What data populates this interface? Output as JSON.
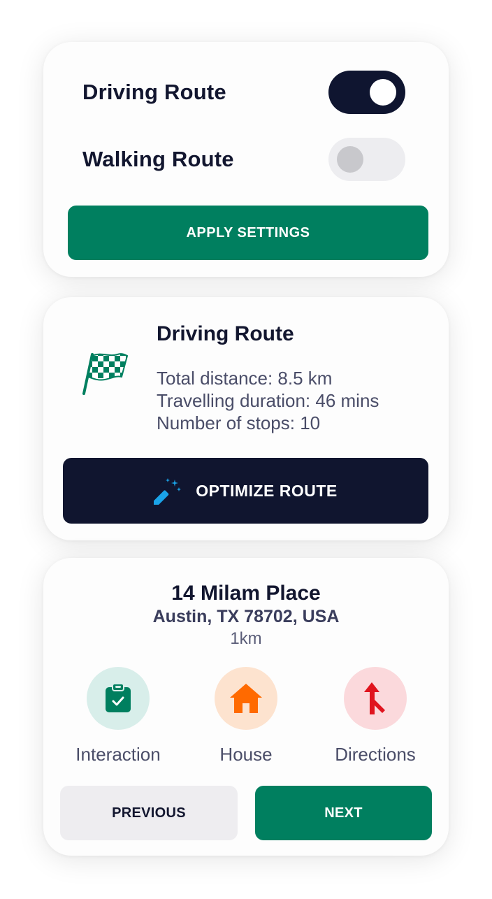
{
  "settings": {
    "driving_label": "Driving Route",
    "driving_on": true,
    "walking_label": "Walking Route",
    "walking_on": false,
    "apply_label": "APPLY SETTINGS"
  },
  "route": {
    "icon": "checkered-flag-icon",
    "title": "Driving Route",
    "total_distance": "Total distance: 8.5 km",
    "duration": "Travelling duration: 46 mins",
    "stops": "Number of stops: 10",
    "optimize_label": "OPTIMIZE ROUTE",
    "optimize_icon": "magic-wand-icon"
  },
  "stop": {
    "address_line1": "14 Milam Place",
    "address_line2": "Austin, TX 78702, USA",
    "distance": "1km",
    "actions": [
      {
        "label": "Interaction",
        "icon": "clipboard-check-icon",
        "color": "#007f5f"
      },
      {
        "label": "House",
        "icon": "house-icon",
        "color": "#ff6a00"
      },
      {
        "label": "Directions",
        "icon": "directions-icon",
        "color": "#e0141e"
      }
    ],
    "previous_label": "PREVIOUS",
    "next_label": "NEXT"
  },
  "colors": {
    "primary_green": "#007f5f",
    "dark_navy": "#10152f"
  }
}
